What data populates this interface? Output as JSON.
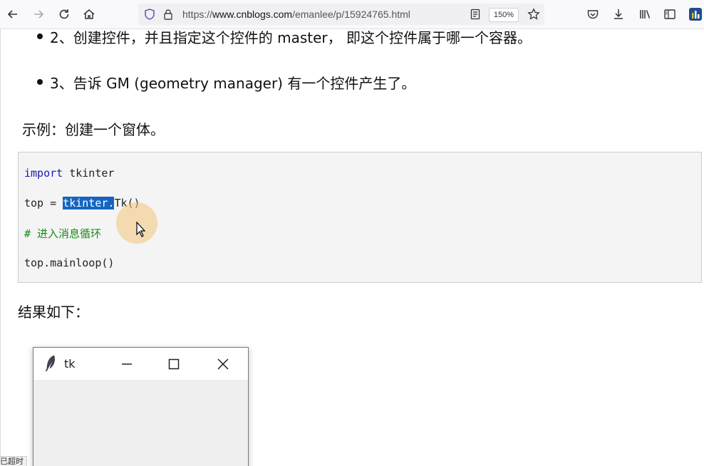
{
  "browser": {
    "url_scheme": "https://",
    "url_host": "www.cnblogs.com",
    "url_path": "/emanlee/p/15924765.html",
    "zoom": "150%"
  },
  "article": {
    "bullets": [
      "2、创建控件，并且指定这个控件的 master， 即这个控件属于哪一个容器。",
      "3、告诉 GM (geometry manager) 有一个控件产生了。"
    ],
    "example_label": "示例：创建一个窗体。",
    "code": {
      "line1_kw": "import",
      "line1_rest": " tkinter",
      "line2_pre": "top = ",
      "line2_sel": "tkinter.",
      "line2_post": "Tk()",
      "line3": "# 进入消息循环",
      "line4": "top.mainloop()"
    },
    "result_label": "结果如下："
  },
  "tk_window": {
    "title": "tk"
  },
  "status_text": "已超时"
}
